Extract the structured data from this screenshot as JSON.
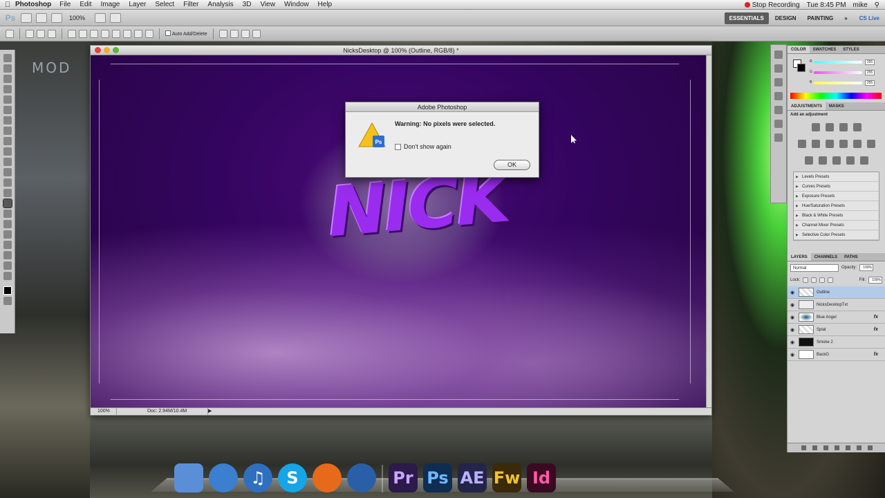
{
  "menubar": {
    "app": "Photoshop",
    "items": [
      "File",
      "Edit",
      "Image",
      "Layer",
      "Select",
      "Filter",
      "Analysis",
      "3D",
      "View",
      "Window",
      "Help"
    ],
    "recording": "Stop Recording",
    "time": "Tue 8:45 PM",
    "user": "mike"
  },
  "appbar": {
    "zoom": "100%",
    "workspaces": [
      "ESSENTIALS",
      "DESIGN",
      "PAINTING"
    ],
    "more": "»",
    "cslive": "CS Live"
  },
  "options": {
    "auto_add_delete": "Auto Add/Delete"
  },
  "document": {
    "title": "NicksDesktop @ 100% (Outline, RGB/8) *",
    "canvas_text": "NICK",
    "status_zoom": "100%",
    "status_doc": "Doc: 2.94M/10.4M"
  },
  "dialog": {
    "title": "Adobe Photoshop",
    "message": "Warning: No pixels were selected.",
    "checkbox": "Don't show again",
    "ok": "OK",
    "icon_badge": "Ps"
  },
  "color_panel": {
    "tabs": [
      "COLOR",
      "SWATCHES",
      "STYLES"
    ],
    "channels": [
      {
        "label": "R",
        "value": "255",
        "color": "#ff4d4d"
      },
      {
        "label": "G",
        "value": "255",
        "color": "#4dff4d"
      },
      {
        "label": "B",
        "value": "255",
        "color": "#4d79ff"
      }
    ]
  },
  "adjustments": {
    "tabs": [
      "ADJUSTMENTS",
      "MASKS"
    ],
    "title": "Add an adjustment",
    "presets": [
      "Levels Presets",
      "Curves Presets",
      "Exposure Presets",
      "Hue/Saturation Presets",
      "Black & White Presets",
      "Channel Mixer Presets",
      "Selective Color Presets"
    ]
  },
  "layers_panel": {
    "tabs": [
      "LAYERS",
      "CHANNELS",
      "PATHS"
    ],
    "blend_mode": "Normal",
    "opacity_label": "Opacity:",
    "opacity": "100%",
    "lock_label": "Lock:",
    "fill_label": "Fill:",
    "fill": "100%",
    "layers": [
      {
        "name": "Outline",
        "active": true,
        "fx": ""
      },
      {
        "name": "NicksDesktopTxt",
        "active": false,
        "fx": ""
      },
      {
        "name": "Blue Angel",
        "active": false,
        "fx": "fx"
      },
      {
        "name": "Splat",
        "active": false,
        "fx": "fx"
      },
      {
        "name": "Smoke 2",
        "active": false,
        "fx": ""
      },
      {
        "name": "BackG",
        "active": false,
        "fx": "fx"
      }
    ]
  },
  "wallpaper": {
    "text": "MOD"
  },
  "dock": {
    "apps": [
      {
        "name": "Finder",
        "label": "",
        "color": "#5a8fd8"
      },
      {
        "name": "QuickTime",
        "label": "",
        "color": "#3a7fd0"
      },
      {
        "name": "iTunes",
        "label": "♫",
        "color": "#2f6fc0"
      },
      {
        "name": "Skype",
        "label": "S",
        "color": "#16a5e6"
      },
      {
        "name": "Firefox",
        "label": "",
        "color": "#e66a1a"
      },
      {
        "name": "Internet",
        "label": "",
        "color": "#2a5fa8"
      },
      {
        "name": "Premiere",
        "label": "Pr",
        "color": "#2b1a4a"
      },
      {
        "name": "Photoshop",
        "label": "Ps",
        "color": "#0f2d52"
      },
      {
        "name": "After Effects",
        "label": "AE",
        "color": "#24244a"
      },
      {
        "name": "Fireworks",
        "label": "Fw",
        "color": "#3a2a0a"
      },
      {
        "name": "InDesign",
        "label": "Id",
        "color": "#3a0a22"
      }
    ]
  }
}
